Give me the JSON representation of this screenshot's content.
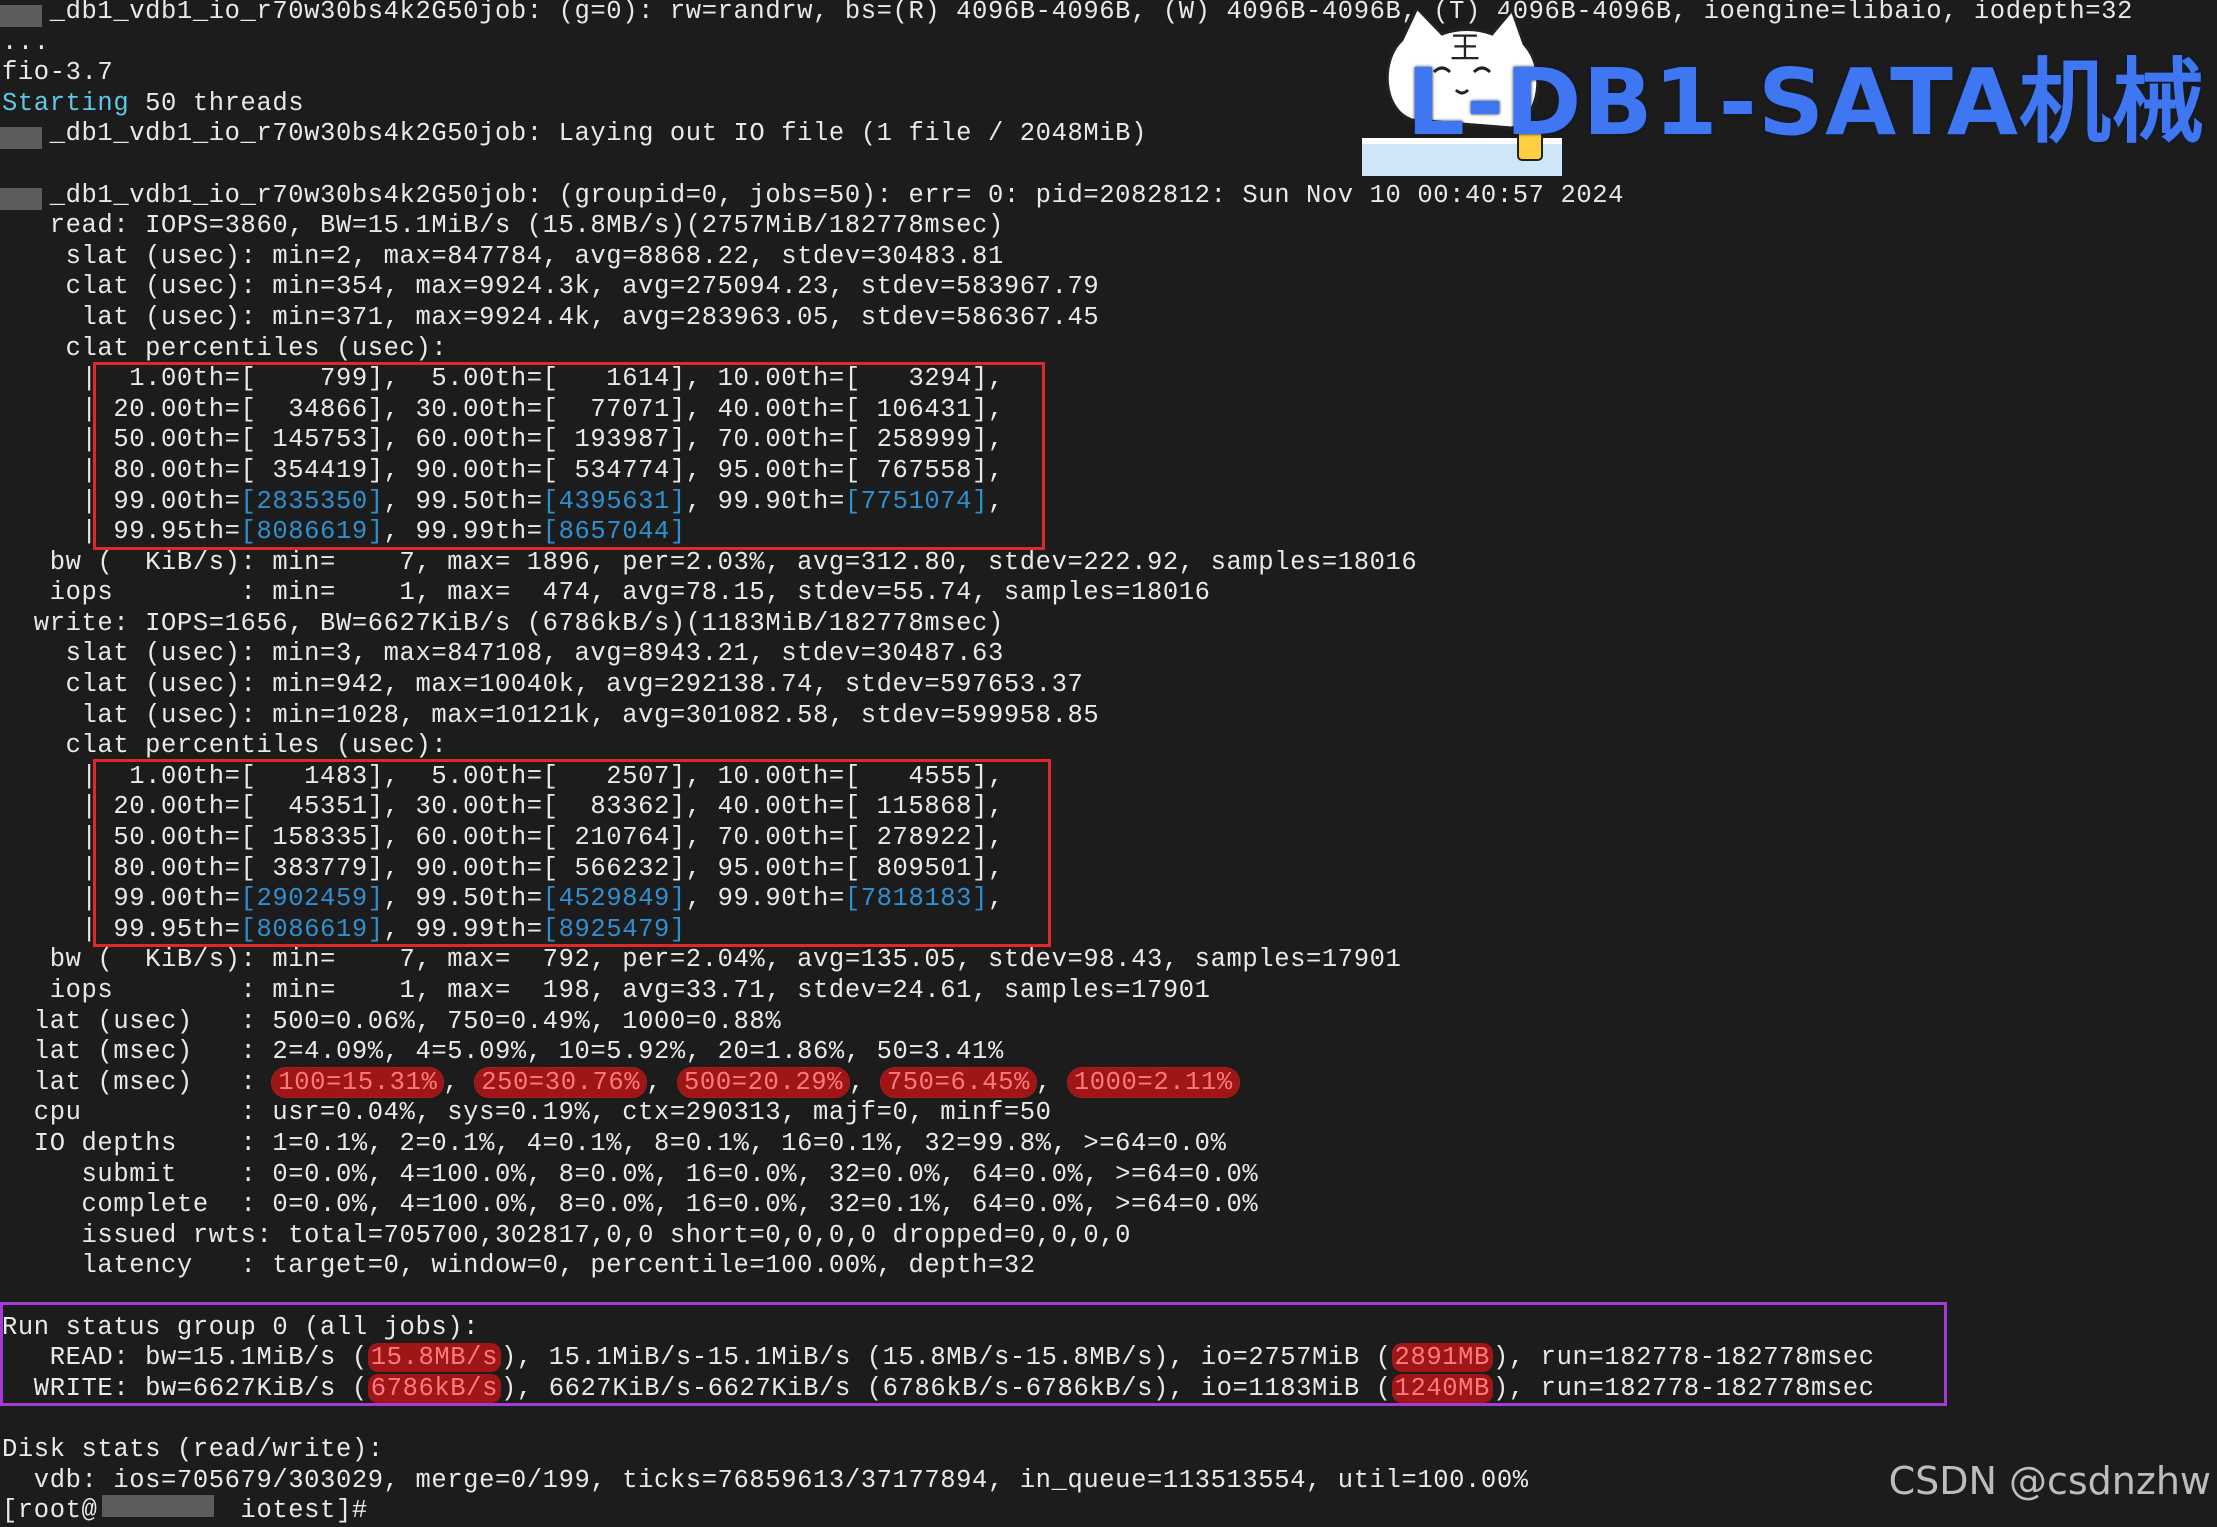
{
  "terminal": {
    "lines": [
      "   _db1_vdb1_io_r70w30bs4k2G50job: (g=0): rw=randrw, bs=(R) 4096B-4096B, (W) 4096B-4096B, (T) 4096B-4096B, ioengine=libaio, iodepth=32",
      "...",
      "fio-3.7",
      "<cyan>Starting</cyan> 50 threads",
      "   _db1_vdb1_io_r70w30bs4k2G50job: Laying out IO file (1 file / 2048MiB)",
      "",
      "   _db1_vdb1_io_r70w30bs4k2G50job: (groupid=0, jobs=50): err= 0: pid=2082812: Sun Nov 10 00:40:57 2024",
      "   read: IOPS=3860, BW=15.1MiB/s (15.8MB/s)(2757MiB/182778msec)",
      "    slat (usec): min=2, max=847784, avg=8868.22, stdev=30483.81",
      "    clat (usec): min=354, max=9924.3k, avg=275094.23, stdev=583967.79",
      "     lat (usec): min=371, max=9924.4k, avg=283963.05, stdev=586367.45",
      "    clat percentiles (usec):",
      "     |  1.00th=[    799],  5.00th=[   1614], 10.00th=[   3294],",
      "     | 20.00th=[  34866], 30.00th=[  77071], 40.00th=[ 106431],",
      "     | 50.00th=[ 145753], 60.00th=[ 193987], 70.00th=[ 258999],",
      "     | 80.00th=[ 354419], 90.00th=[ 534774], 95.00th=[ 767558],",
      "     | 99.00th=<blue>[2835350]</blue>, 99.50th=<blue>[4395631]</blue>, 99.90th=<blue>[7751074]</blue>,",
      "     | 99.95th=<blue>[8086619]</blue>, 99.99th=<blue>[8657044]</blue>",
      "   bw (  KiB/s): min=    7, max= 1896, per=2.03%, avg=312.80, stdev=222.92, samples=18016",
      "   iops        : min=    1, max=  474, avg=78.15, stdev=55.74, samples=18016",
      "  write: IOPS=1656, BW=6627KiB/s (6786kB/s)(1183MiB/182778msec)",
      "    slat (usec): min=3, max=847108, avg=8943.21, stdev=30487.63",
      "    clat (usec): min=942, max=10040k, avg=292138.74, stdev=597653.37",
      "     lat (usec): min=1028, max=10121k, avg=301082.58, stdev=599958.85",
      "    clat percentiles (usec):",
      "     |  1.00th=[   1483],  5.00th=[   2507], 10.00th=[   4555],",
      "     | 20.00th=[  45351], 30.00th=[  83362], 40.00th=[ 115868],",
      "     | 50.00th=[ 158335], 60.00th=[ 210764], 70.00th=[ 278922],",
      "     | 80.00th=[ 383779], 90.00th=[ 566232], 95.00th=[ 809501],",
      "     | 99.00th=<blue>[2902459]</blue>, 99.50th=<blue>[4529849]</blue>, 99.90th=<blue>[7818183]</blue>,",
      "     | 99.95th=<blue>[8086619]</blue>, 99.99th=<blue>[8925479]</blue>",
      "   bw (  KiB/s): min=    7, max=  792, per=2.04%, avg=135.05, stdev=98.43, samples=17901",
      "   iops        : min=    1, max=  198, avg=33.71, stdev=24.61, samples=17901",
      "  lat (usec)   : 500=0.06%, 750=0.49%, 1000=0.88%",
      "  lat (msec)   : 2=4.09%, 4=5.09%, 10=5.92%, 20=1.86%, 50=3.41%",
      "  lat (msec)   : <pill>100=15.31%</pill>, <pill>250=30.76%</pill>, <pill>500=20.29%</pill>, <pill>750=6.45%</pill>, <pill>1000=2.11%</pill>",
      "  cpu          : usr=0.04%, sys=0.19%, ctx=290313, majf=0, minf=50",
      "  IO depths    : 1=0.1%, 2=0.1%, 4=0.1%, 8=0.1%, 16=0.1%, 32=99.8%, >=64=0.0%",
      "     submit    : 0=0.0%, 4=100.0%, 8=0.0%, 16=0.0%, 32=0.0%, 64=0.0%, >=64=0.0%",
      "     complete  : 0=0.0%, 4=100.0%, 8=0.0%, 16=0.0%, 32=0.1%, 64=0.0%, >=64=0.0%",
      "     issued rwts: total=705700,302817,0,0 short=0,0,0,0 dropped=0,0,0,0",
      "     latency   : target=0, window=0, percentile=100.00%, depth=32",
      "",
      "Run status group 0 (all jobs):",
      "   READ: bw=15.1MiB/s (<red>15.8MB/s</red>), 15.1MiB/s-15.1MiB/s (15.8MB/s-15.8MB/s), io=2757MiB (<red>2891MB</red>), run=182778-182778msec",
      "  WRITE: bw=6627KiB/s (<red>6786kB/s</red>), 6627KiB/s-6627KiB/s (6786kB/s-6786kB/s), io=1183MiB (<red>1240MB</red>), run=182778-182778msec",
      "",
      "Disk stats (read/write):",
      "  vdb: ios=705679/303029, merge=0/199, ticks=76859613/37177894, in_queue=113513554, util=100.00%",
      "[root@         iotest]# "
    ]
  },
  "overlay": {
    "title": "L-DB1-SATA机械",
    "watermark": "CSDN @csdnzhw",
    "sticker_text": "王"
  },
  "colors": {
    "background": "#1c1c1c",
    "text": "#e9e9e9",
    "highlight_cyan": "#5fc7e8",
    "percentile_blue": "#2f8fd0",
    "box_red": "#e0282a",
    "box_purple": "#a23cd6",
    "title_blue": "#3f76f1"
  }
}
